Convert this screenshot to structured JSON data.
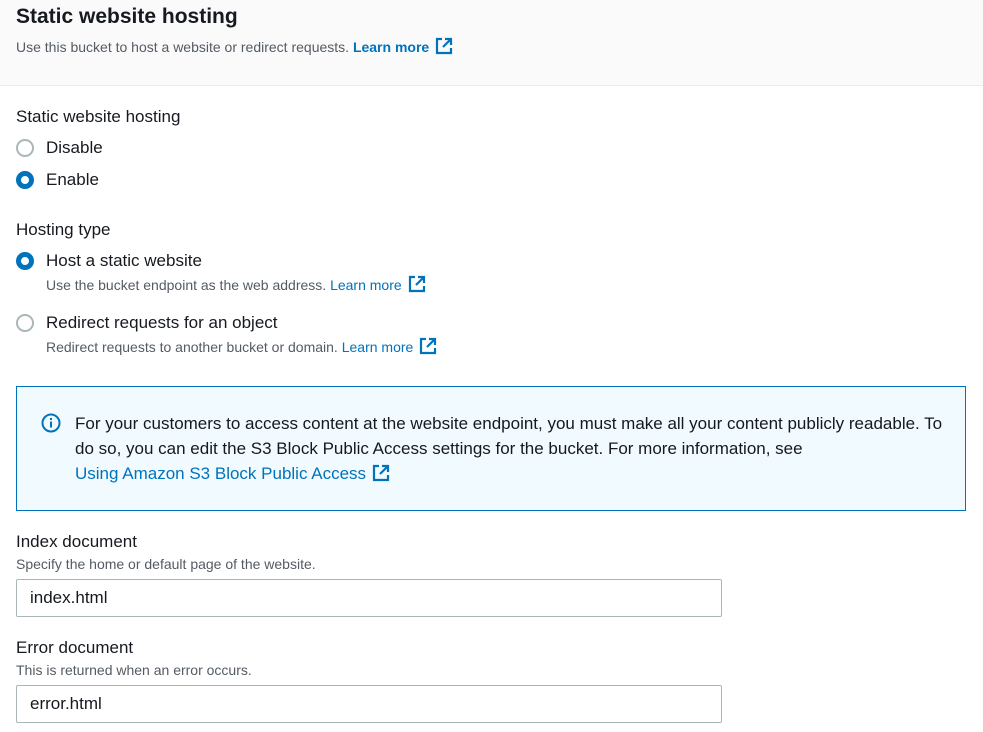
{
  "header": {
    "title": "Static website hosting",
    "description": "Use this bucket to host a website or redirect requests.",
    "learn_more": "Learn more"
  },
  "hosting_toggle": {
    "label": "Static website hosting",
    "options": [
      {
        "label": "Disable",
        "checked": false
      },
      {
        "label": "Enable",
        "checked": true
      }
    ]
  },
  "hosting_type": {
    "label": "Hosting type",
    "options": [
      {
        "label": "Host a static website",
        "description": "Use the bucket endpoint as the web address.",
        "learn_more": "Learn more",
        "checked": true
      },
      {
        "label": "Redirect requests for an object",
        "description": "Redirect requests to another bucket or domain.",
        "learn_more": "Learn more",
        "checked": false
      }
    ]
  },
  "info_alert": {
    "text": "For your customers to access content at the website endpoint, you must make all your content publicly readable. To do so, you can edit the S3 Block Public Access settings for the bucket. For more information, see",
    "link": "Using Amazon S3 Block Public Access",
    "icon": "info-icon"
  },
  "index_document": {
    "label": "Index document",
    "description": "Specify the home or default page of the website.",
    "value": "index.html"
  },
  "error_document": {
    "label": "Error document",
    "description": "This is returned when an error occurs.",
    "value": "error.html"
  },
  "colors": {
    "accent": "#0073bb",
    "info_bg": "#f1faff",
    "header_bg": "#fafafa",
    "text": "#16191f",
    "muted_text": "#545b64"
  }
}
